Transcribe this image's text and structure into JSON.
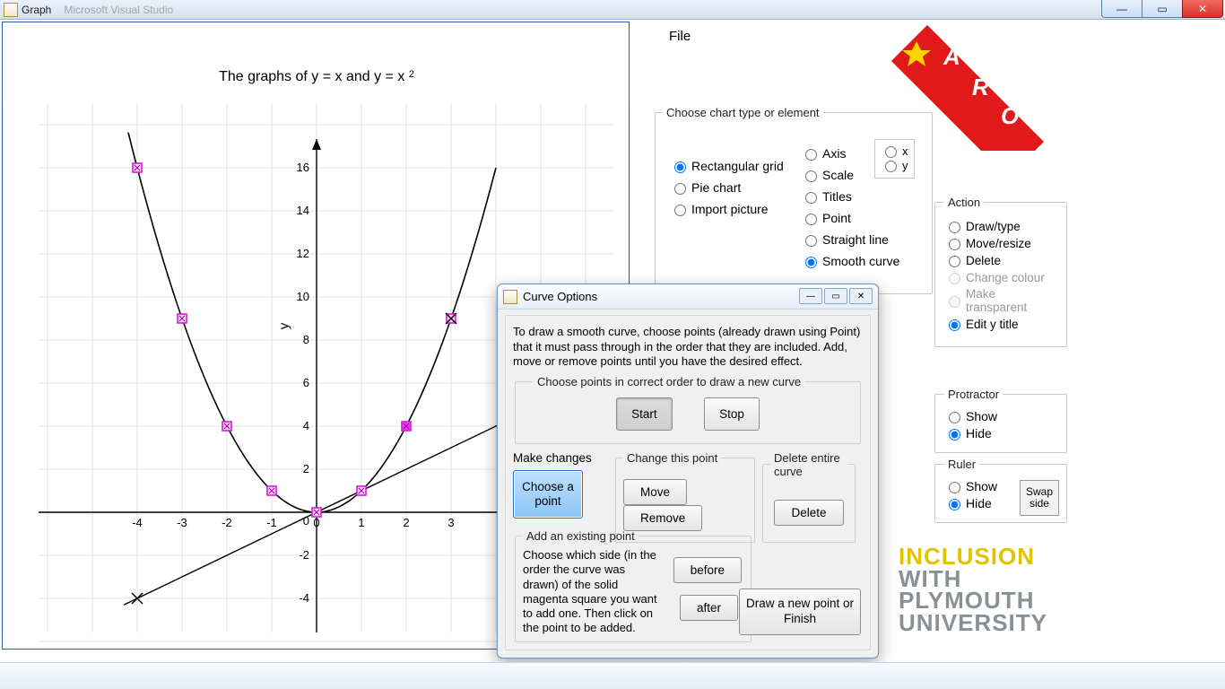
{
  "window": {
    "title": "Graph",
    "faded": "Microsoft Visual Studio"
  },
  "menu": {
    "file": "File"
  },
  "chart_panel": {
    "legend": "Choose chart type or element",
    "types": {
      "rect": "Rectangular grid",
      "pie": "Pie chart",
      "import": "Import picture"
    },
    "elements": {
      "axis": "Axis",
      "scale": "Scale",
      "titles": "Titles",
      "point": "Point",
      "line": "Straight line",
      "curve": "Smooth curve"
    },
    "axes": {
      "x": "x",
      "y": "y"
    }
  },
  "action": {
    "legend": "Action",
    "draw": "Draw/type",
    "move": "Move/resize",
    "delete": "Delete",
    "colour": "Change colour",
    "transparent": "Make transparent",
    "edity": "Edit y title"
  },
  "protractor": {
    "legend": "Protractor",
    "show": "Show",
    "hide": "Hide"
  },
  "ruler": {
    "legend": "Ruler",
    "show": "Show",
    "hide": "Hide",
    "swap": "Swap side"
  },
  "dialog": {
    "title": "Curve Options",
    "intro": "To draw a smooth curve, choose points (already drawn using Point) that it must pass through in the order that they are included. Add, move or remove points until you have the desired effect.",
    "choose_legend": "Choose points in correct order to draw a new curve",
    "start": "Start",
    "stop": "Stop",
    "make": "Make changes",
    "choose_point": "Choose a point",
    "change_legend": "Change this point",
    "move": "Move",
    "remove": "Remove",
    "delete_legend": "Delete entire curve",
    "delete": "Delete",
    "add_legend": "Add an existing point",
    "add_text": "Choose which side (in the order the curve was drawn) of the solid magenta square you want to add one.  Then click on the point to be added.",
    "before": "before",
    "after": "after",
    "draw_finish": "Draw a new point or Finish"
  },
  "ribbon": {
    "a": "A",
    "r": "R",
    "o": "O"
  },
  "logo": {
    "l1": "INCLUSION",
    "l2": "WITH",
    "l3": "PLYMOUTH",
    "l4": "UNIVERSITY"
  },
  "chart_data": {
    "type": "line",
    "title": "The graphs of y = x and y = x²",
    "xlabel": "",
    "ylabel": "y",
    "xlim": [
      -5,
      5
    ],
    "ylim": [
      -5,
      17
    ],
    "grid": true,
    "x_ticks": [
      -4,
      -3,
      -2,
      -1,
      0,
      1,
      2,
      3
    ],
    "y_ticks": [
      -4,
      -2,
      0,
      2,
      4,
      6,
      8,
      10,
      12,
      14,
      16
    ],
    "series": [
      {
        "name": "y = x",
        "x": [
          -4,
          -3,
          -2,
          -1,
          0,
          1,
          2,
          3,
          4
        ],
        "values": [
          -4,
          -3,
          -2,
          -1,
          0,
          1,
          2,
          3,
          4
        ]
      },
      {
        "name": "y = x^2",
        "x": [
          -4,
          -3,
          -2,
          -1,
          0,
          1,
          2,
          3,
          4
        ],
        "values": [
          16,
          9,
          4,
          1,
          0,
          1,
          4,
          9,
          16
        ]
      }
    ],
    "curve_points": [
      {
        "x": -4,
        "y": 16
      },
      {
        "x": -3,
        "y": 9
      },
      {
        "x": -2,
        "y": 4
      },
      {
        "x": -1,
        "y": 1
      },
      {
        "x": 0,
        "y": 0
      },
      {
        "x": 1,
        "y": 1
      },
      {
        "x": 2,
        "y": 4
      },
      {
        "x": 3,
        "y": 9
      }
    ],
    "line_endpoints_crosses": [
      {
        "x": -4,
        "y": -4
      },
      {
        "x": 3,
        "y": 9
      }
    ]
  }
}
